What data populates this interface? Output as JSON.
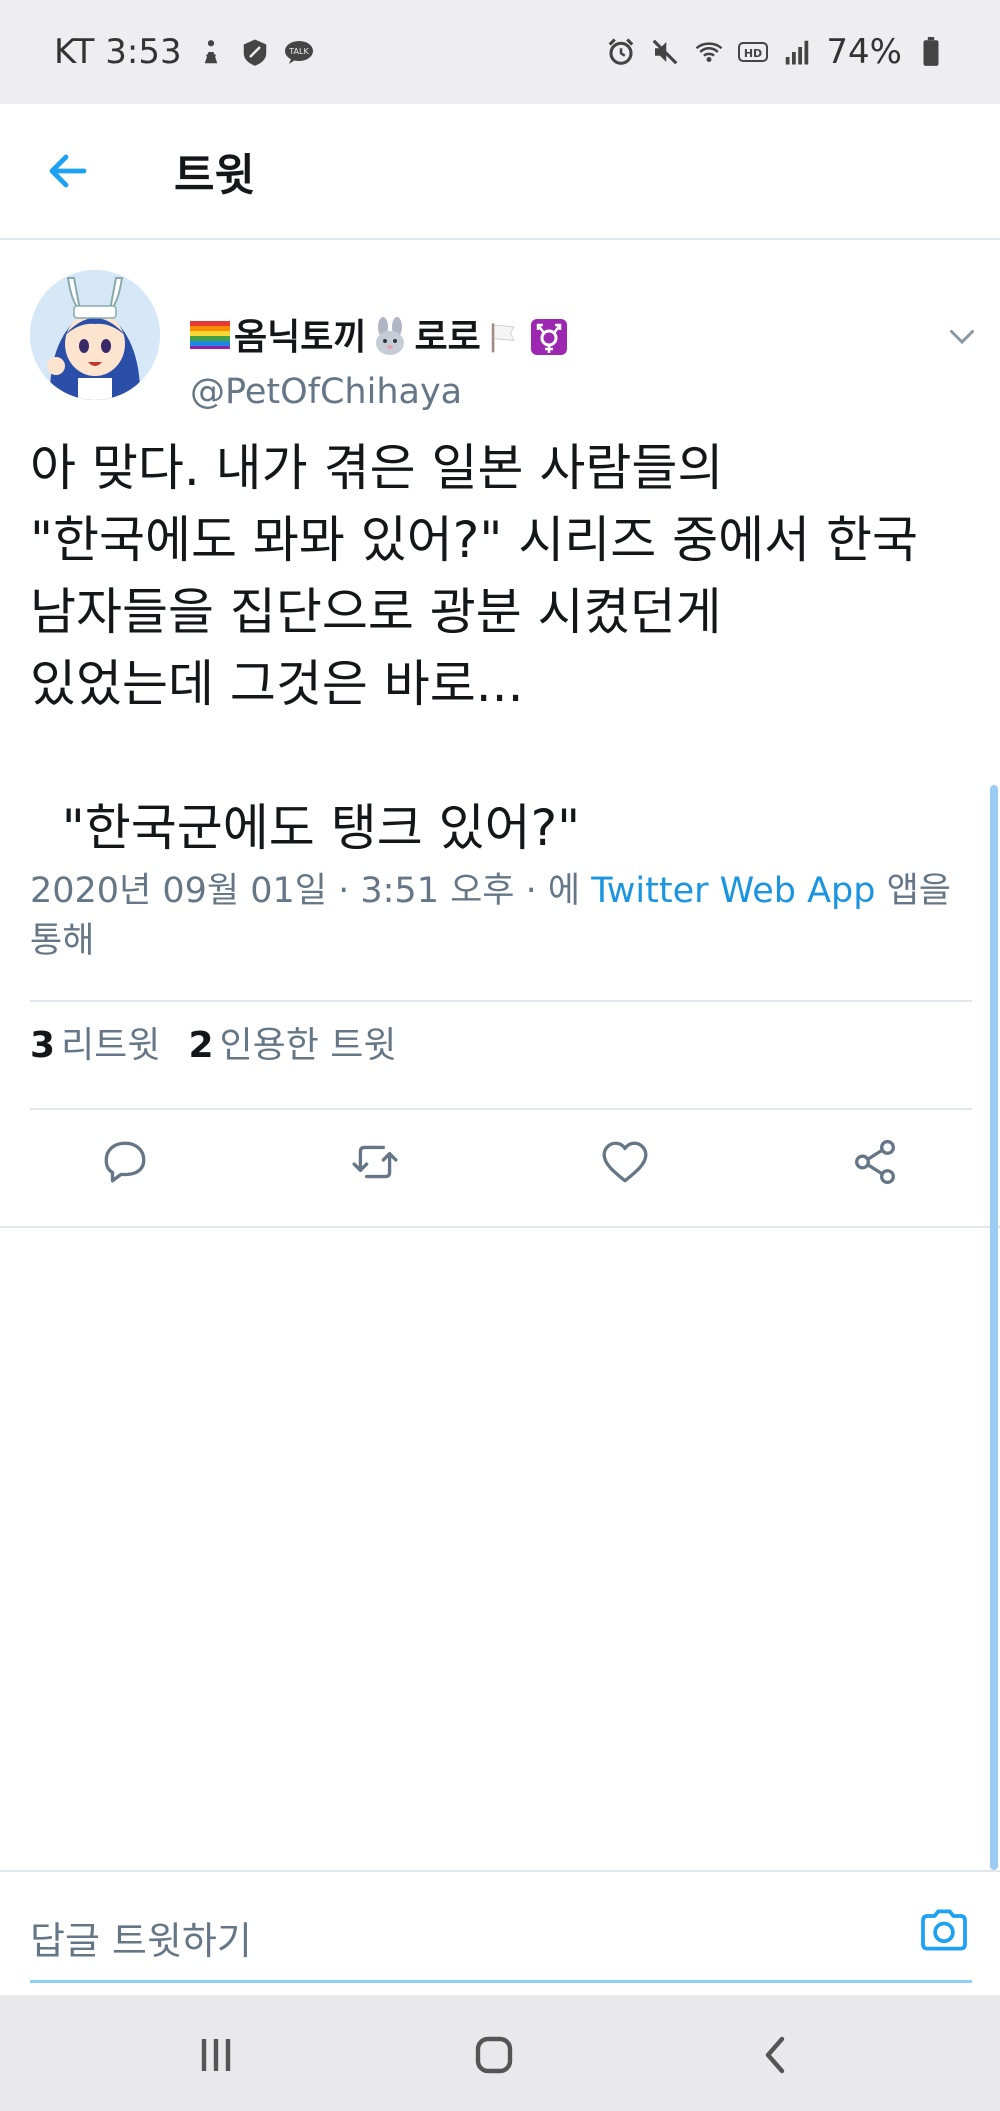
{
  "status_bar": {
    "carrier_time": "KT 3:53",
    "battery": "74%",
    "left_icons": [
      "person-walk-icon",
      "shield-icon",
      "talk-icon"
    ],
    "right_icons": [
      "alarm-icon",
      "mute-icon",
      "wifi-icon",
      "hd-icon",
      "signal-icon",
      "battery-icon"
    ],
    "talk_badge": "TALK",
    "hd_badge": "HD"
  },
  "header": {
    "title": "트윗",
    "back_icon": "arrow-left-icon",
    "accent": "#1da1f2"
  },
  "tweet": {
    "display_name": "옴닉토끼",
    "display_name_suffix": "로로",
    "name_emojis": [
      "rainbow-flag-icon",
      "rabbit-icon",
      "white-flag-icon",
      "transgender-symbol-icon"
    ],
    "handle": "@PetOfChihaya",
    "text": "아 맞다. 내가 겪은 일본 사람들의\n\"한국에도 뫄뫄 있어?\" 시리즈 중에서 한국\n남자들을 집단으로 광분 시켰던게\n있었는데 그것은 바로...\n\n  \"한국군에도 탱크 있어?\"",
    "timestamp": "2020년 09월 01일 · 3:51 오후 · 에",
    "app_name": "Twitter Web App",
    "timestamp_suffix": "앱을 통해",
    "retweet_count": "3",
    "retweet_label": "리트윗",
    "quote_count": "2",
    "quote_label": "인용한 트윗",
    "actions": [
      "reply-icon",
      "retweet-icon",
      "like-icon",
      "share-icon"
    ]
  },
  "reply": {
    "placeholder": "답글 트윗하기",
    "camera_icon": "camera-icon"
  },
  "nav_bar": {
    "buttons": [
      "recent-apps-icon",
      "home-icon",
      "back-icon"
    ]
  },
  "colors": {
    "link": "#1b95e0",
    "muted": "#657786",
    "text": "#14171a",
    "divider": "#e1e8ed"
  }
}
